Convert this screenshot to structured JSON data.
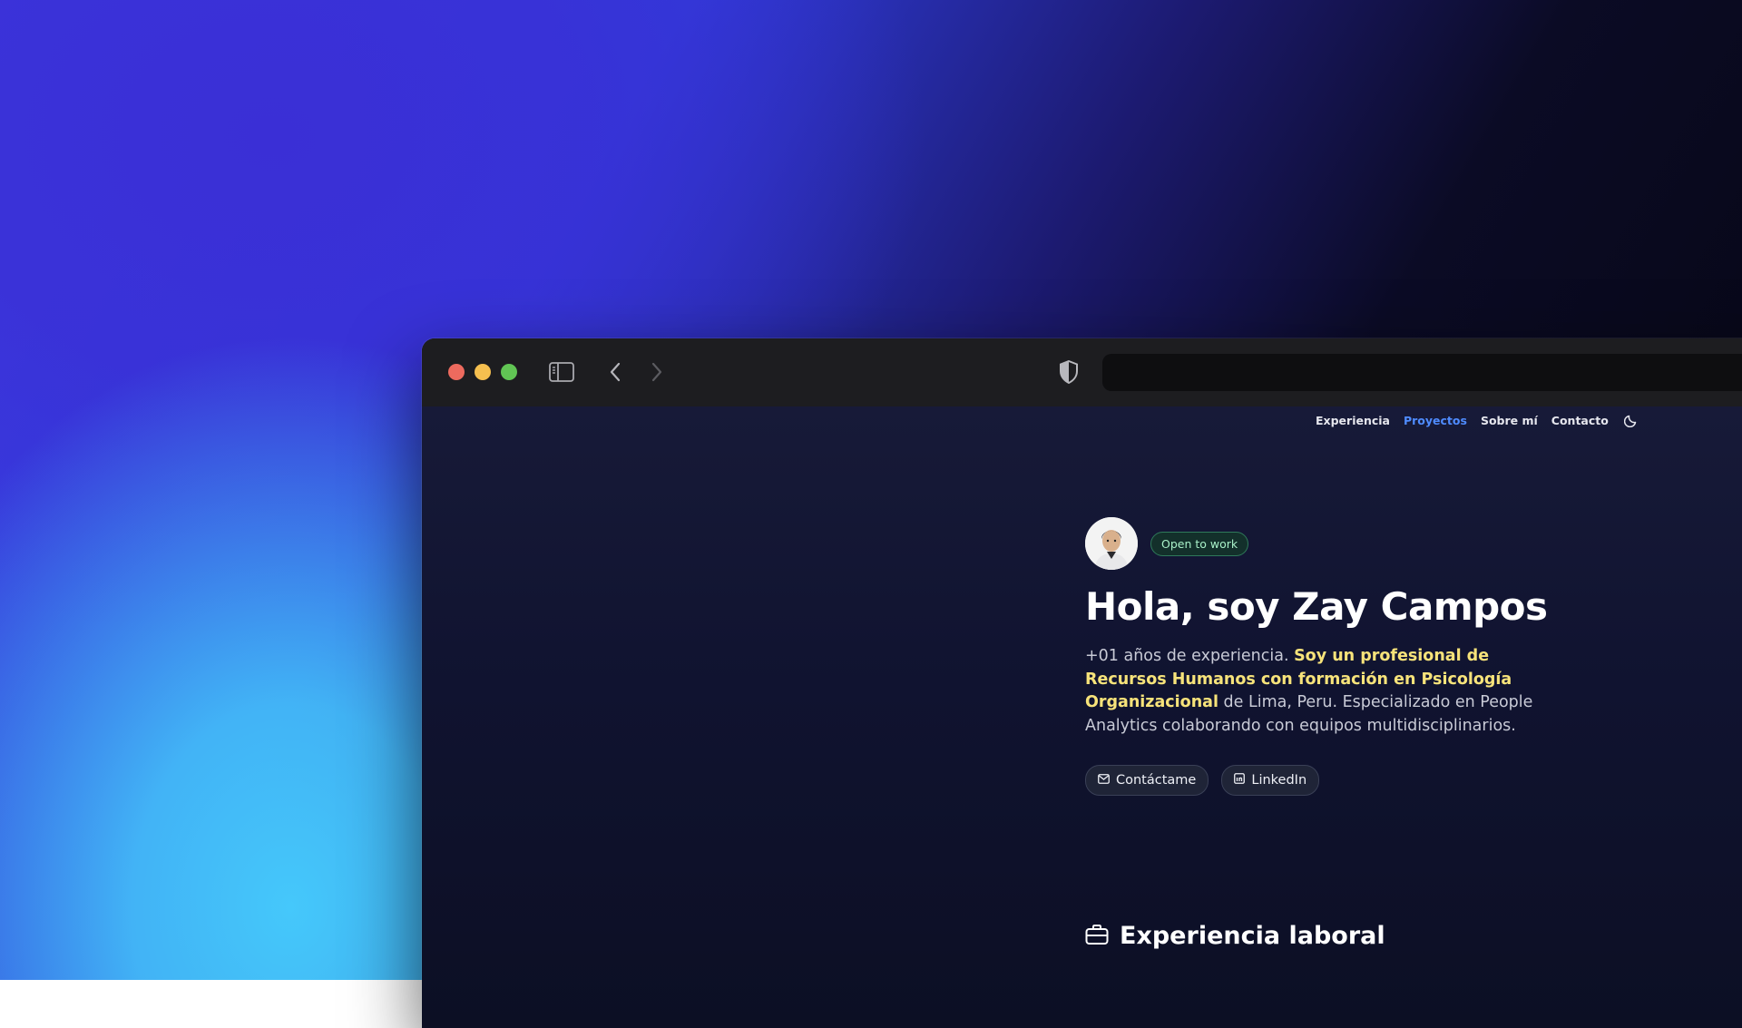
{
  "browser": {
    "icons": {
      "sidebar": "sidebar-toggle-icon",
      "back": "chevron-left-icon",
      "forward": "chevron-right-icon",
      "privacy": "shield-icon"
    },
    "address_bar": ""
  },
  "nav": {
    "items": [
      {
        "label": "Experiencia",
        "active": false
      },
      {
        "label": "Proyectos",
        "active": true
      },
      {
        "label": "Sobre mí",
        "active": false
      },
      {
        "label": "Contacto",
        "active": false
      }
    ],
    "theme_icon": "moon-icon"
  },
  "hero": {
    "badge": "Open to work",
    "title": "Hola, soy Zay Campos",
    "intro_part1": "+01 años de experiencia. ",
    "intro_highlight": "Soy un profesional de Recursos Humanos con formación en Psicología Organizacional",
    "intro_part2": " de Lima, Peru. Especializado en People Analytics colaborando con equipos multidisciplinarios.",
    "buttons": {
      "contact": "Contáctame",
      "linkedin": "LinkedIn"
    }
  },
  "section": {
    "title": "Experiencia laboral",
    "icon": "briefcase-icon"
  },
  "colors": {
    "accent": "#4f8cff",
    "highlight": "#f7e37a",
    "badge_text": "#a8f0c8"
  }
}
